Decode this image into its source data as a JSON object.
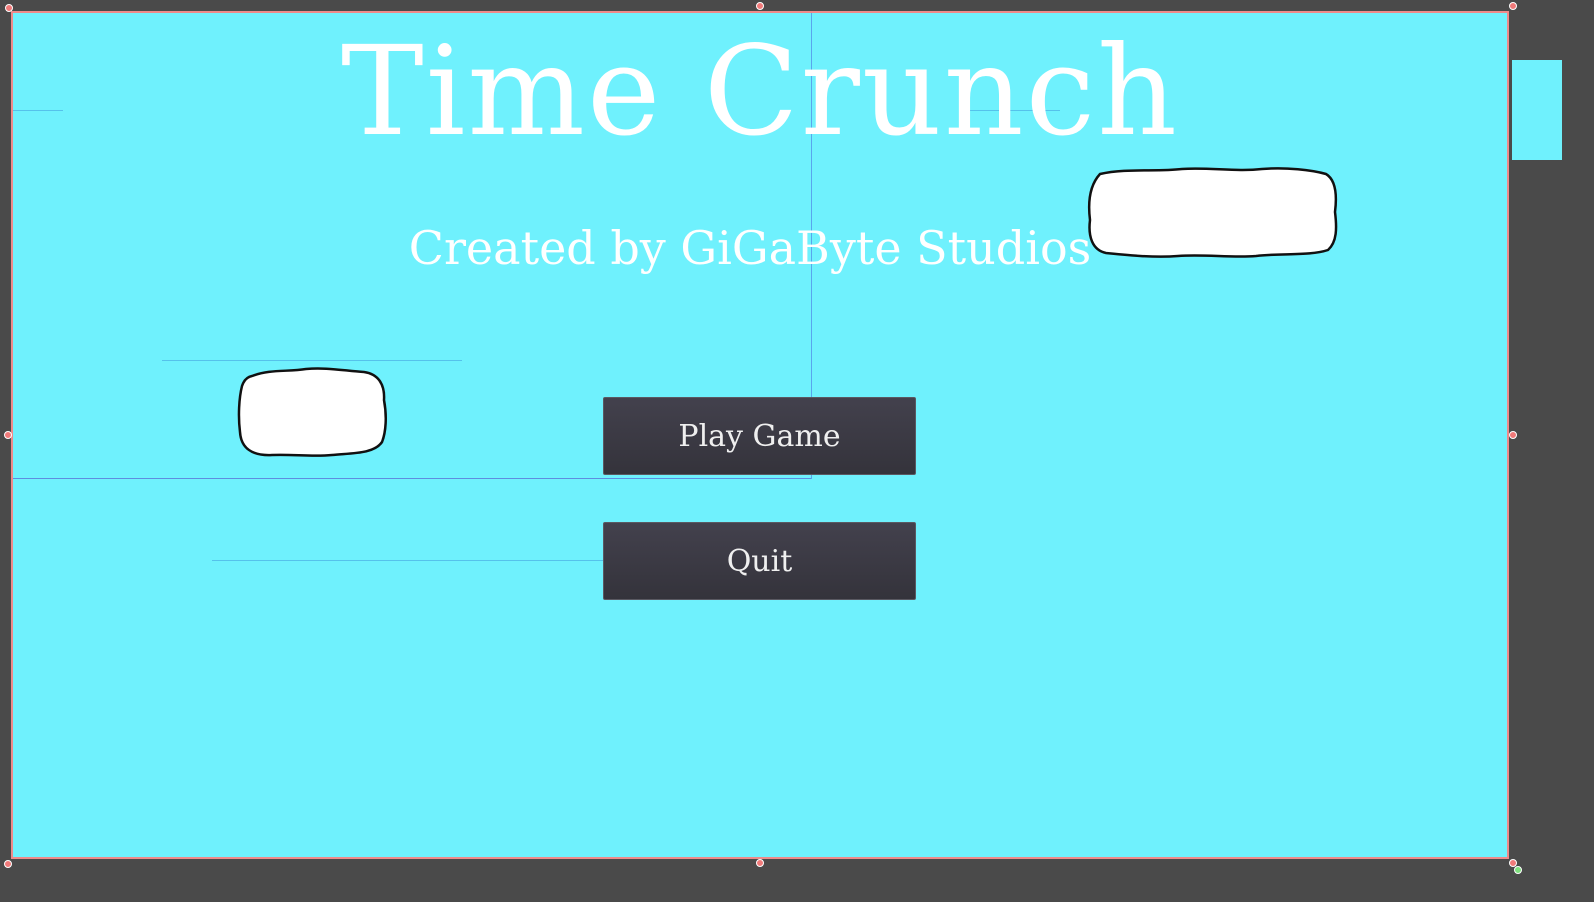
{
  "scene": {
    "title": "Time Crunch",
    "subtitle": "Created by GiGaByte Studios",
    "background_color": "#6ff1fd"
  },
  "menu": {
    "play_label": "Play Game",
    "quit_label": "Quit",
    "button_color": "#3a3942",
    "button_text_color": "#efefef"
  },
  "editor": {
    "frame_color": "#ef8a8a",
    "backdrop_color": "#4a4a4a"
  }
}
